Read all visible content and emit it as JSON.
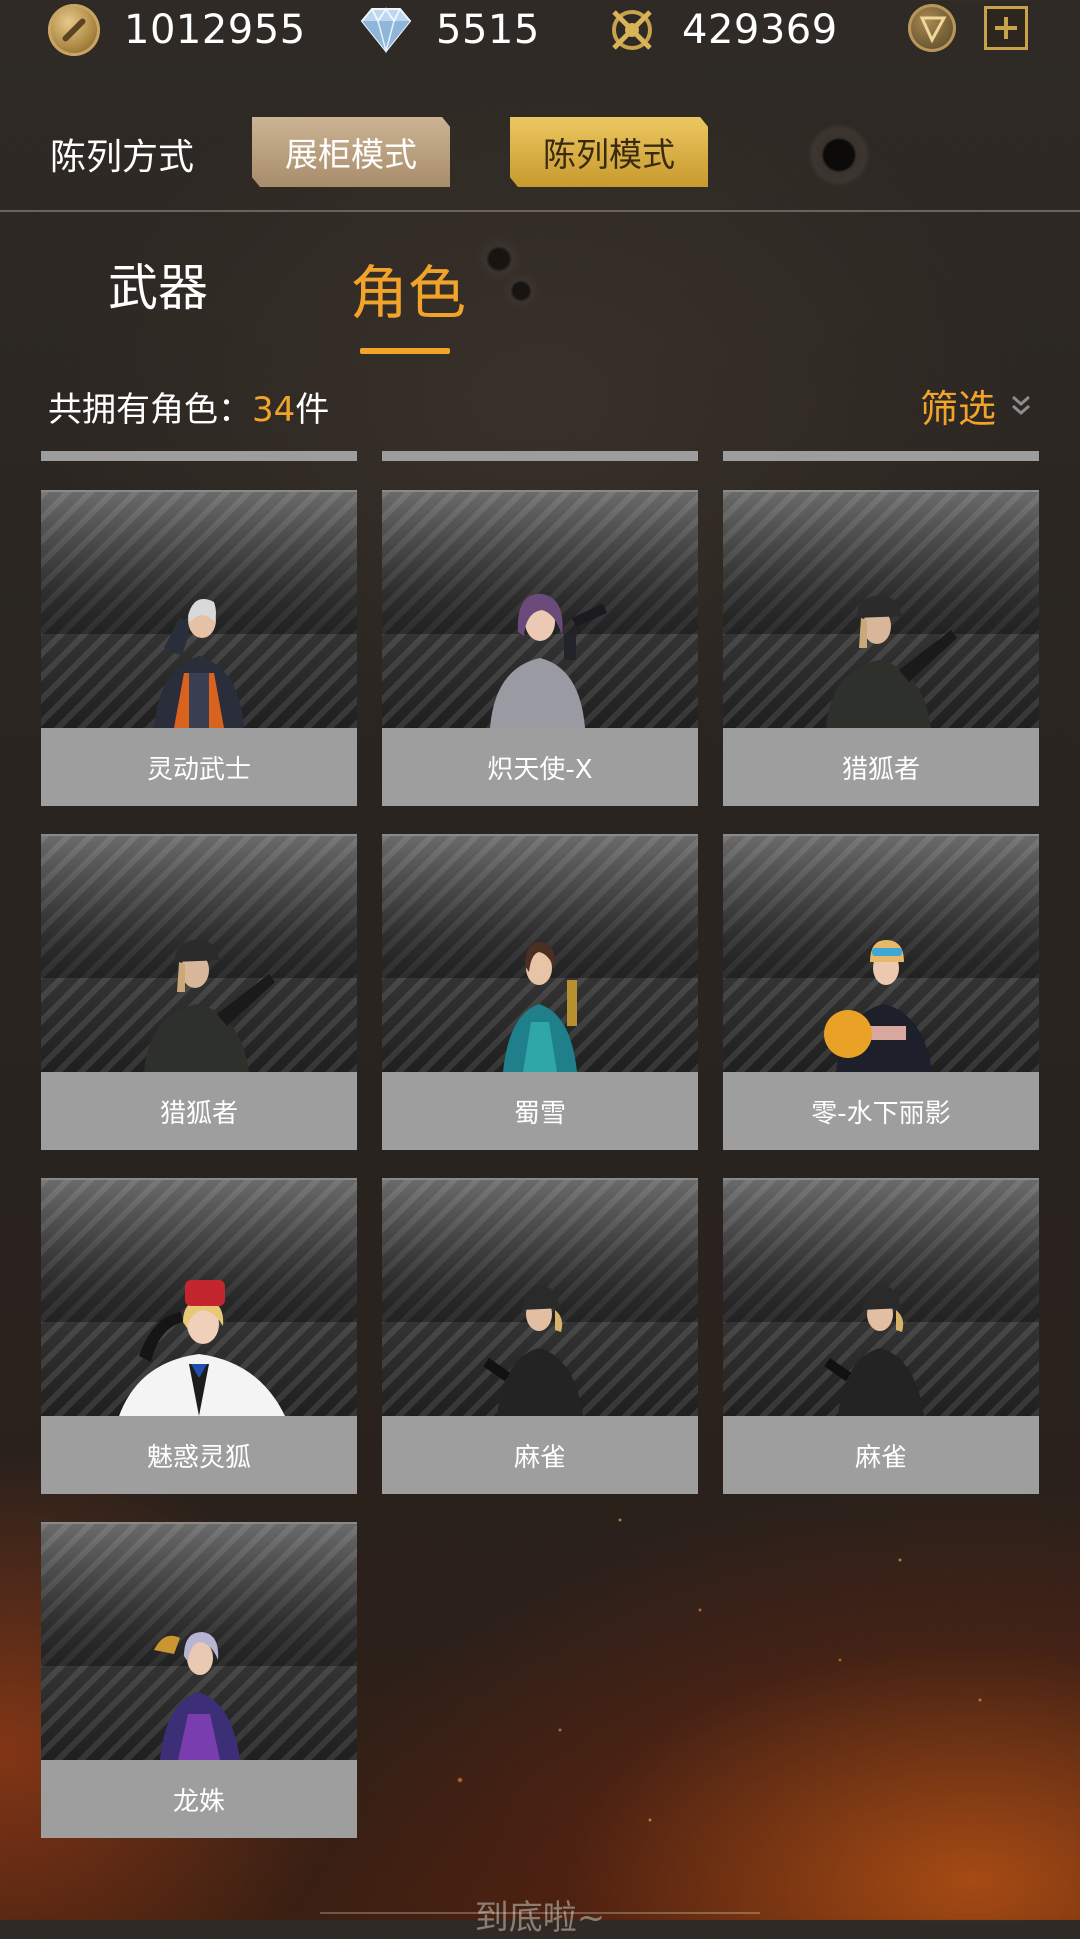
{
  "currencies": {
    "gold": "1012955",
    "diamond": "5515",
    "medal": "429369"
  },
  "display_mode": {
    "label": "陈列方式",
    "showcase_label": "展柜模式",
    "list_label": "陈列模式"
  },
  "tabs": {
    "weapon": "武器",
    "role": "角色"
  },
  "summary": {
    "prefix": "共拥有角色：",
    "count": "34",
    "suffix": "件",
    "filter_label": "筛选"
  },
  "characters": [
    {
      "name": "灵动武士"
    },
    {
      "name": "炽天使-X"
    },
    {
      "name": "猎狐者"
    },
    {
      "name": "猎狐者"
    },
    {
      "name": "蜀雪"
    },
    {
      "name": "零-水下丽影"
    },
    {
      "name": "魅惑灵狐"
    },
    {
      "name": "麻雀"
    },
    {
      "name": "麻雀"
    },
    {
      "name": "龙姝"
    }
  ],
  "footer": {
    "end_text": "到底啦~"
  },
  "colors": {
    "accent": "#f2a42a",
    "card_label_bg": "#9e9e9e"
  }
}
